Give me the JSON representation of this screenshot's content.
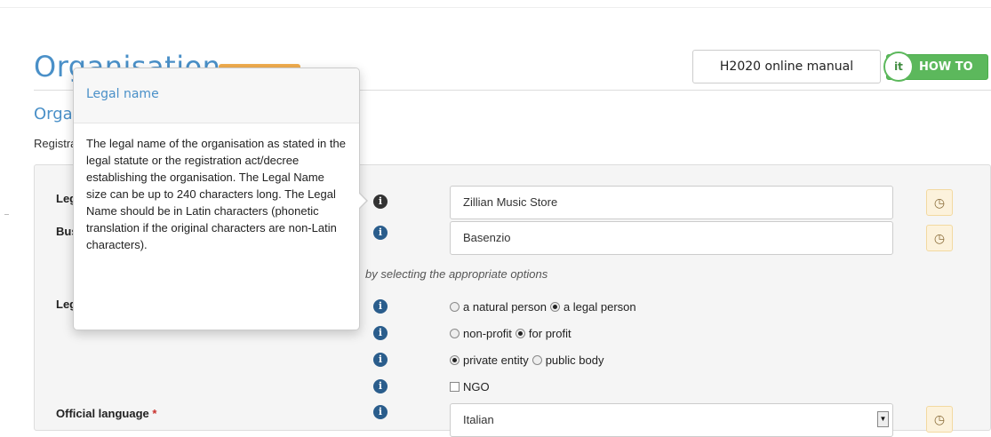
{
  "header": {
    "title": "Organisation",
    "section_title": "Organisation data",
    "registration_text": "Registration data",
    "manual_button": "H2020 online manual",
    "howto_button": "HOW TO",
    "howto_icon_text": "it"
  },
  "form": {
    "legal_name_label": "Legal name",
    "business_name_label": "Business name",
    "legal_status_label": "Legal status",
    "description_text": "by selecting the appropriate options",
    "legal_name_value": "Zillian Music Store",
    "business_name_value": "Basenzio",
    "official_language_label": "Official language",
    "official_language_value": "Italian",
    "required_mark": "*",
    "options": {
      "natural_person": "a natural person",
      "legal_person": "a legal person",
      "non_profit": "non-profit",
      "for_profit": "for profit",
      "private_entity": "private entity",
      "public_body": "public body",
      "ngo": "NGO"
    },
    "selected": {
      "person_type": "a legal person",
      "profit_type": "for profit",
      "entity_type": "private entity",
      "ngo_checked": false
    }
  },
  "popover": {
    "title": "Legal name",
    "body": "The legal name of the organisation as stated in the legal statute or the registration act/decree establishing the organisation. The Legal Name size can be up to 240 characters long. The Legal Name should be in Latin characters (phonetic translation if the original characters are non-Latin characters)."
  },
  "icons": {
    "info": "info-icon",
    "history": "clock-icon",
    "dropdown": "chevron-down-icon"
  },
  "colors": {
    "accent": "#4a90c8",
    "howto_green": "#5cb85c",
    "badge_orange": "#f0ad4e"
  }
}
